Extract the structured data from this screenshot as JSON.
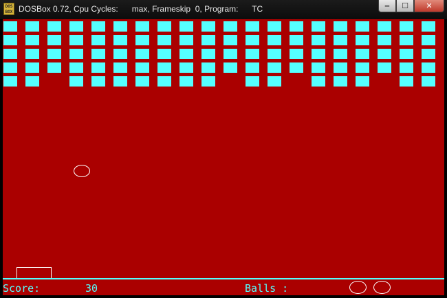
{
  "window": {
    "title": "DOSBox 0.72, Cpu Cycles:      max, Frameskip  0, Program:      TC",
    "icon_text": [
      "DOS",
      "BOX"
    ],
    "buttons": {
      "minimize": "‒",
      "maximize": "☐",
      "close": "✕"
    }
  },
  "game": {
    "colors": {
      "background": "#aa0000",
      "brick": "#55ffff",
      "ball": "#ffffff",
      "hud_text": "#55ffff"
    },
    "bricks": [
      [
        1,
        1,
        1,
        1,
        1,
        1,
        1,
        1,
        1,
        1,
        1,
        1,
        1,
        1,
        1,
        1,
        1,
        1,
        1,
        1
      ],
      [
        1,
        1,
        1,
        1,
        1,
        1,
        1,
        1,
        1,
        1,
        1,
        1,
        1,
        1,
        1,
        1,
        1,
        1,
        1,
        1
      ],
      [
        1,
        1,
        1,
        1,
        1,
        1,
        1,
        1,
        1,
        1,
        1,
        1,
        1,
        1,
        1,
        1,
        1,
        1,
        1,
        1
      ],
      [
        1,
        1,
        1,
        1,
        1,
        1,
        1,
        1,
        1,
        1,
        1,
        1,
        1,
        1,
        1,
        1,
        1,
        1,
        1,
        1
      ],
      [
        1,
        1,
        0,
        1,
        1,
        1,
        1,
        1,
        1,
        1,
        0,
        1,
        1,
        0,
        1,
        1,
        1,
        0,
        1,
        1
      ]
    ],
    "hud": {
      "score_label": "Score:",
      "score_value": "30",
      "balls_label": "Balls :",
      "balls_remaining": 2
    }
  }
}
